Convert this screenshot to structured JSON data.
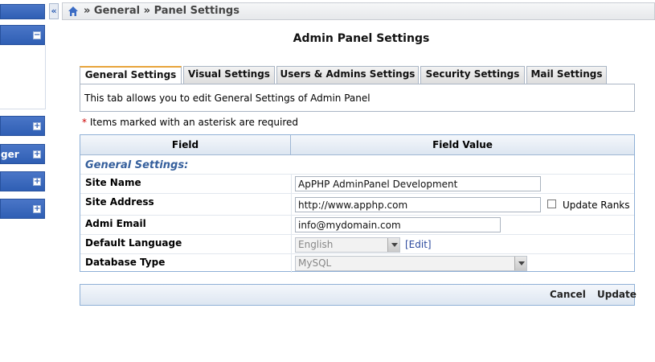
{
  "breadcrumb": {
    "text": "» General » Panel Settings"
  },
  "sidebar": {
    "collapse_glyph": "«",
    "headers": [
      {
        "label": "",
        "toggle": "−"
      },
      {
        "label": "",
        "toggle": "+"
      },
      {
        "label": "ger",
        "toggle": "+"
      },
      {
        "label": "",
        "toggle": "+"
      },
      {
        "label": "",
        "toggle": "+"
      }
    ]
  },
  "page": {
    "title": "Admin Panel Settings"
  },
  "tabs": [
    {
      "label": "General Settings",
      "active": true
    },
    {
      "label": "Visual Settings"
    },
    {
      "label": "Users & Admins Settings"
    },
    {
      "label": "Security Settings"
    },
    {
      "label": "Mail Settings"
    }
  ],
  "tab_description": "This tab allows you to edit General Settings of Admin Panel",
  "required_note": {
    "star": "*",
    "text": " Items marked with an asterisk are required"
  },
  "table": {
    "headers": {
      "field": "Field",
      "value": "Field Value"
    },
    "section": "General Settings:",
    "rows": [
      {
        "label": "Site Name",
        "value": "ApPHP AdminPanel Development"
      },
      {
        "label": "Site Address",
        "value": "http://www.apphp.com",
        "checkbox_label": "Update Ranks"
      },
      {
        "label": "Admi Email",
        "value": "info@mydomain.com"
      },
      {
        "label": "Default Language",
        "value": "English",
        "link": "[Edit]"
      },
      {
        "label": "Database Type",
        "value": "MySQL"
      }
    ]
  },
  "footer": {
    "cancel": "Cancel",
    "update": "Update"
  },
  "colors": {
    "accent": "#2f5fb4",
    "tab_active_top": "#e8a53b",
    "section_text": "#355f9c"
  },
  "icons": {
    "home": "home-icon"
  }
}
